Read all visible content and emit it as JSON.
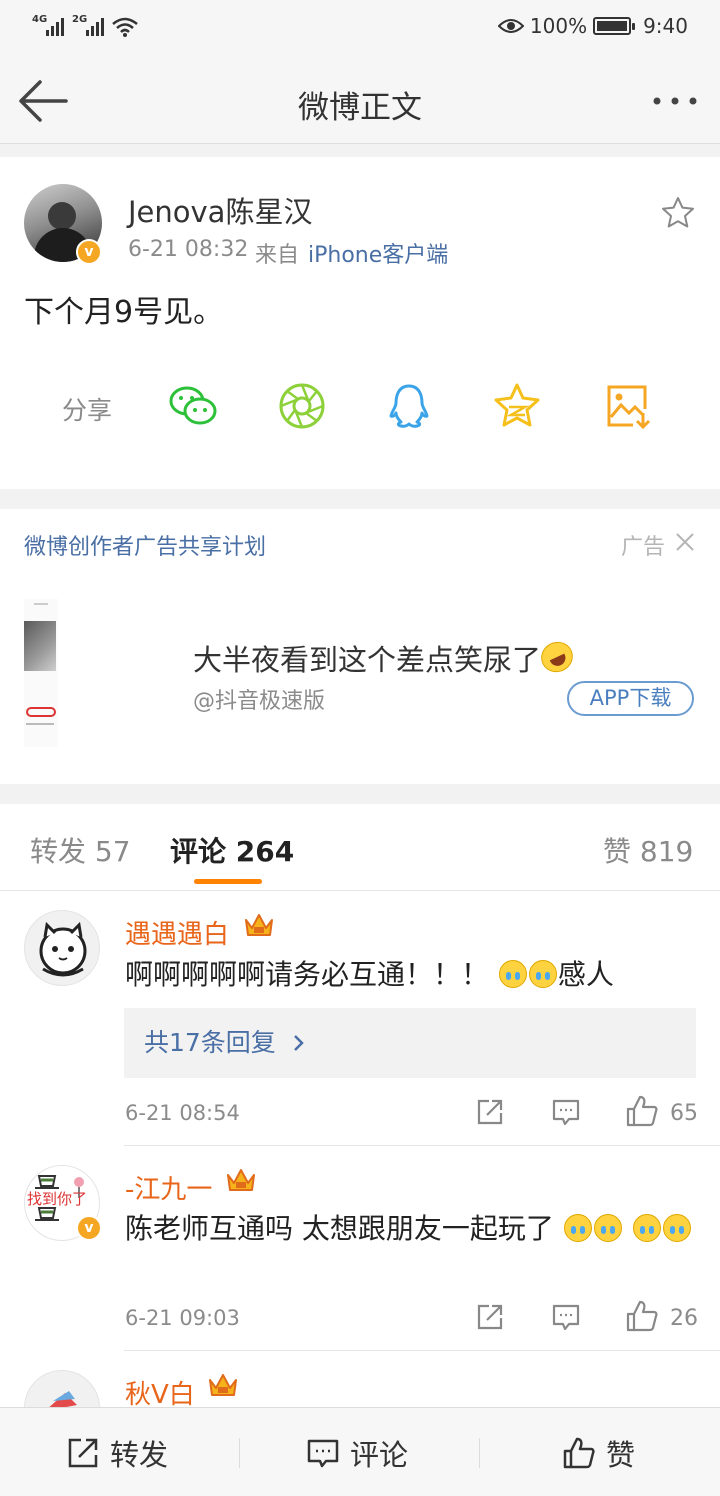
{
  "status_bar": {
    "signal_1": "4G",
    "signal_2": "2G",
    "battery": "100%",
    "time": "9:40"
  },
  "nav": {
    "title": "微博正文"
  },
  "post": {
    "author": "Jenova陈星汉",
    "time": "6-21 08:32",
    "from_label": "来自",
    "source": "iPhone客户端",
    "text": "下个月9号见。",
    "share_label": "分享",
    "share_icons": [
      "wechat-icon",
      "moments-icon",
      "qq-icon",
      "qzone-icon",
      "save-image-icon"
    ]
  },
  "ad": {
    "plan_label": "微博创作者广告共享计划",
    "ad_tag": "广告",
    "title": "大半夜看到这个差点笑尿了",
    "source": "@抖音极速版",
    "download_label": "APP下载"
  },
  "tabs": {
    "reposts": "转发 57",
    "comments": "评论 264",
    "likes": "赞 819"
  },
  "comments": [
    {
      "name": "遇遇遇白",
      "text": "啊啊啊啊啊请务必互通！！！",
      "text_suffix": "感人",
      "replies": "共17条回复",
      "time": "6-21 08:54",
      "likes": "65"
    },
    {
      "name": "-江九一",
      "avatar_text": "找到你了",
      "text": "陈老师互通吗 太想跟朋友一起玩了",
      "time": "6-21 09:03",
      "likes": "26"
    },
    {
      "name": "秋V白"
    }
  ],
  "bottom_bar": {
    "repost": "转发",
    "comment": "评论",
    "like": "赞"
  },
  "colors": {
    "accent": "#ff8200",
    "link": "#4a6fa5",
    "username": "#e8651a",
    "verified": "#f5a623"
  }
}
